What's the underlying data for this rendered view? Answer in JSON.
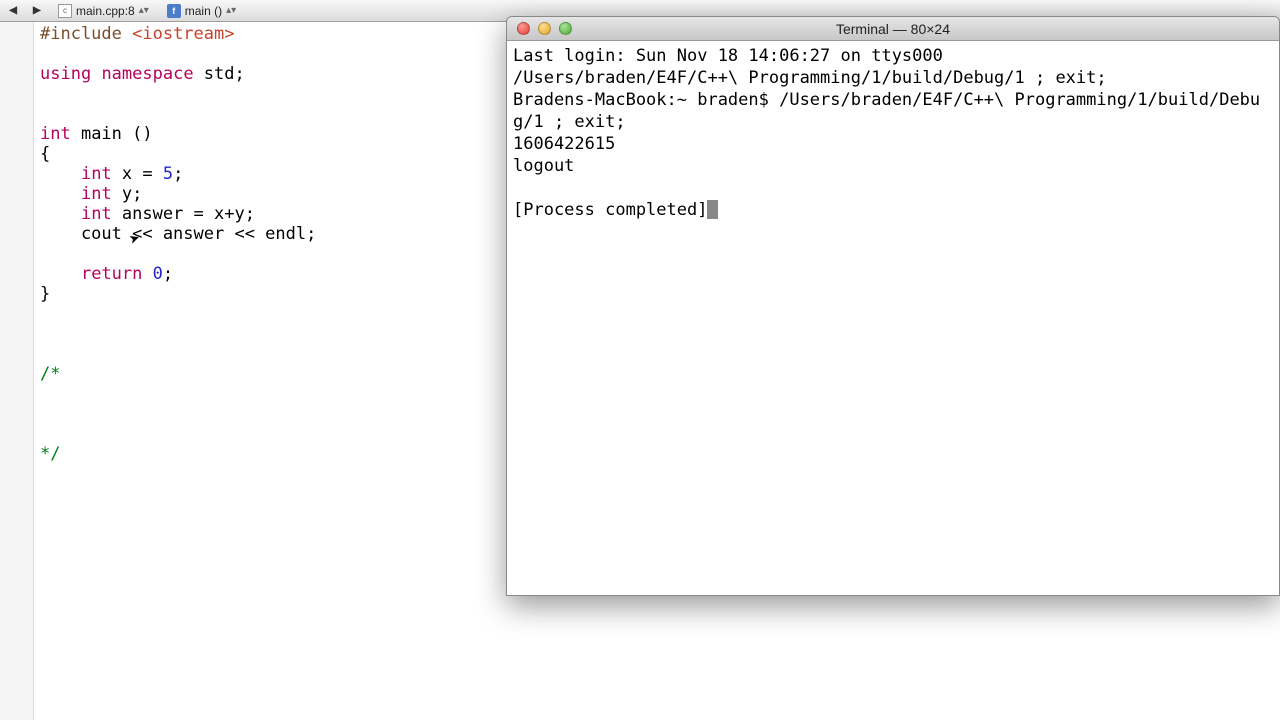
{
  "toolbar": {
    "file_crumb": "main.cpp:8",
    "func_crumb": "main ()"
  },
  "code": {
    "line1_pp": "#include ",
    "line1_inc": "<iostream>",
    "line3_kw1": "using",
    "line3_kw2": "namespace",
    "line3_id": " std;",
    "line6_kw": "int",
    "line6_rest": " main ()",
    "line7": "{",
    "line8_kw": "int",
    "line8_rest": " x = ",
    "line8_num": "5",
    "line8_semi": ";",
    "line9_kw": "int",
    "line9_rest": " y;",
    "line10_kw": "int",
    "line10_rest": " answer = x+y;",
    "line11": "    cout << answer << endl;",
    "line13_kw": "return",
    "line13_num": "0",
    "line13_semi": ";",
    "line14": "}",
    "c_open": "/*",
    "c_close": "*/"
  },
  "terminal": {
    "title": "Terminal — 80×24",
    "line1": "Last login: Sun Nov 18 14:06:27 on ttys000",
    "line2": "/Users/braden/E4F/C++\\ Programming/1/build/Debug/1 ; exit;",
    "line3": "Bradens-MacBook:~ braden$ /Users/braden/E4F/C++\\ Programming/1/build/Debug/1 ; exit;",
    "line4": "1606422615",
    "line5": "logout",
    "line7": "[Process completed]"
  }
}
